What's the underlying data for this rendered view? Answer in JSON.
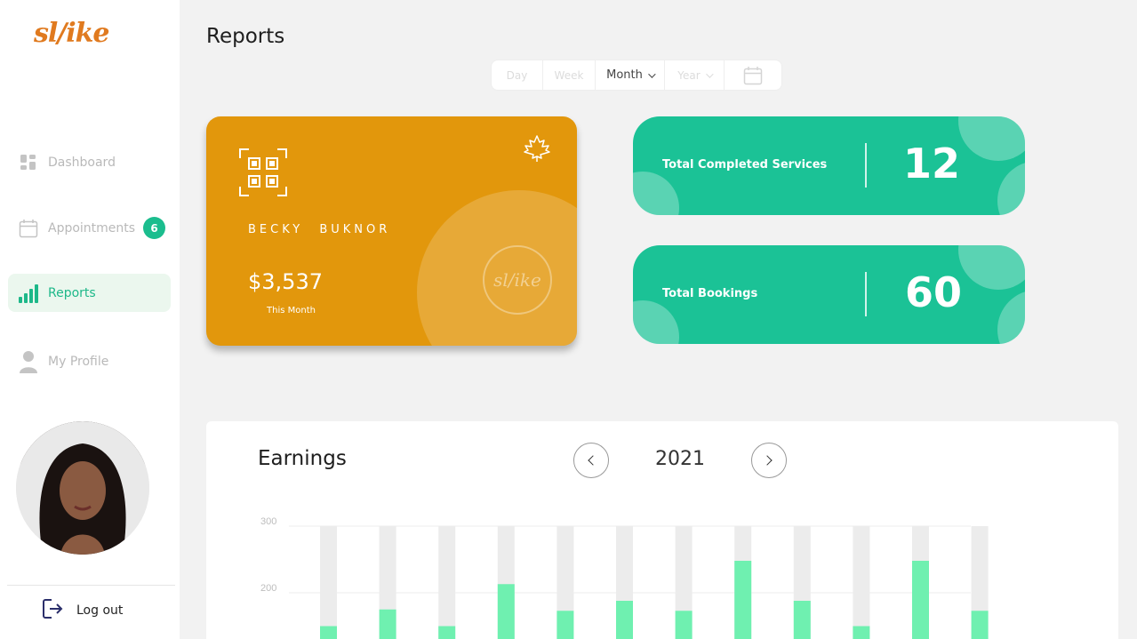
{
  "sidebar": {
    "logo": "sl/ike",
    "items": [
      {
        "label": "Dashboard",
        "icon": "dashboard-icon"
      },
      {
        "label": "Appointments",
        "icon": "calendar-icon",
        "badge": "6"
      },
      {
        "label": "Reports",
        "icon": "bar-chart-icon",
        "active": true
      },
      {
        "label": "My Profile",
        "icon": "user-icon"
      }
    ],
    "logout": "Log out"
  },
  "header": {
    "title": "Reports"
  },
  "period": {
    "options": [
      "Day",
      "Week",
      "Month",
      "Year"
    ],
    "selected": "Month"
  },
  "card": {
    "holder": "BECKY BUKNOR",
    "amount": "$3,537",
    "amount_label": "This Month",
    "seal_text": "sl/ike"
  },
  "stats": [
    {
      "label": "Total Completed Services",
      "value": "12"
    },
    {
      "label": "Total Bookings",
      "value": "60"
    }
  ],
  "earnings": {
    "title": "Earnings",
    "year": "2021"
  },
  "colors": {
    "accent": "#1bc296",
    "card": "#e2970c",
    "bar_fill": "#6ff0b0",
    "bar_track": "#ececec"
  },
  "chart_data": {
    "type": "bar",
    "yticks": [
      300,
      200
    ],
    "ylim_visible": [
      170,
      300
    ],
    "values": [
      150,
      175,
      150,
      213,
      173,
      188,
      173,
      248,
      188,
      150,
      248,
      173
    ],
    "max": 300
  }
}
